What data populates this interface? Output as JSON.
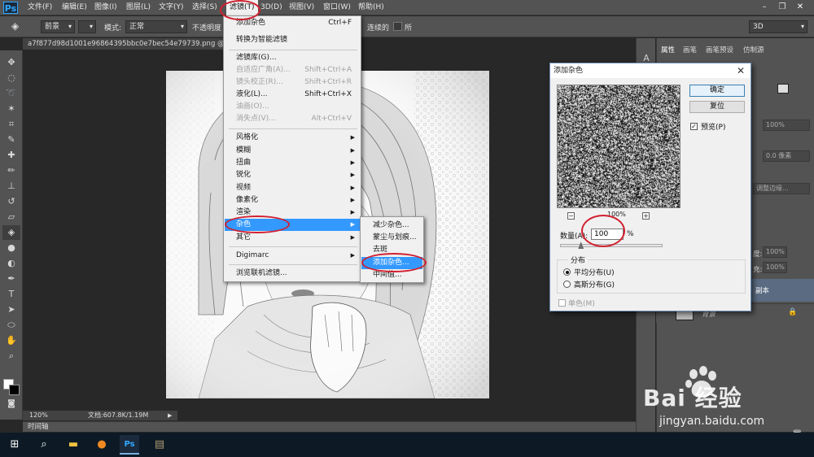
{
  "app": {
    "logo": "Ps"
  },
  "menubar": {
    "items": [
      "文件(F)",
      "编辑(E)",
      "图像(I)",
      "图层(L)",
      "文字(Y)",
      "选择(S)",
      "滤镜(T)",
      "3D(D)",
      "视图(V)",
      "窗口(W)",
      "帮助(H)"
    ],
    "window_controls": {
      "minimize": "–",
      "restore": "❐",
      "close": "✕"
    }
  },
  "options_bar": {
    "preset_value": "前景",
    "mode_label": "模式:",
    "mode_value": "正常",
    "opacity_label": "不透明度",
    "contiguous_label": "连续的",
    "all_layers_label": "所",
    "workspace_value": "3D"
  },
  "document": {
    "tab_title": "a7f877d98d1001e96864395bbc0e7bec54e79739.png @ 12",
    "zoom": "120%",
    "doc_size": "文档:607.8K/1.19M"
  },
  "timeline_label": "时间轴",
  "filter_menu": {
    "items": [
      {
        "label": "添加杂色",
        "shortcut": "Ctrl+F",
        "enabled": true
      },
      {
        "label": "转换为智能滤镜",
        "shortcut": "",
        "enabled": true
      },
      {
        "label": "滤镜库(G)...",
        "shortcut": "",
        "enabled": true
      },
      {
        "label": "自适应广角(A)...",
        "shortcut": "Shift+Ctrl+A",
        "enabled": false
      },
      {
        "label": "镜头校正(R)...",
        "shortcut": "Shift+Ctrl+R",
        "enabled": false
      },
      {
        "label": "液化(L)...",
        "shortcut": "Shift+Ctrl+X",
        "enabled": true
      },
      {
        "label": "油画(O)...",
        "shortcut": "",
        "enabled": false
      },
      {
        "label": "消失点(V)...",
        "shortcut": "Alt+Ctrl+V",
        "enabled": false
      },
      {
        "label": "风格化",
        "submenu": true
      },
      {
        "label": "模糊",
        "submenu": true
      },
      {
        "label": "扭曲",
        "submenu": true
      },
      {
        "label": "锐化",
        "submenu": true
      },
      {
        "label": "视频",
        "submenu": true
      },
      {
        "label": "像素化",
        "submenu": true
      },
      {
        "label": "渲染",
        "submenu": true
      },
      {
        "label": "杂色",
        "submenu": true,
        "highlighted": true
      },
      {
        "label": "其它",
        "submenu": true
      },
      {
        "label": "Digimarc",
        "submenu": true
      },
      {
        "label": "浏览联机滤镜...",
        "shortcut": ""
      }
    ]
  },
  "noise_submenu": {
    "items": [
      {
        "label": "减少杂色..."
      },
      {
        "label": "蒙尘与划痕..."
      },
      {
        "label": "去斑"
      },
      {
        "label": "添加杂色...",
        "highlighted": true
      },
      {
        "label": "中间值..."
      }
    ]
  },
  "dialog": {
    "title": "添加杂色",
    "close": "✕",
    "ok_label": "确定",
    "reset_label": "复位",
    "preview_label": "预览(P)",
    "preview_checked": true,
    "zoom_level": "100%",
    "zoom_out": "−",
    "zoom_in": "+",
    "amount_label": "数量(A):",
    "amount_value": "100",
    "amount_unit": "%",
    "amount_slider_fraction": 0.2,
    "distribution_label": "分布",
    "uniform_label": "平均分布(U)",
    "gaussian_label": "高斯分布(G)",
    "selected_distribution": "uniform",
    "mono_label": "单色(M)"
  },
  "right_panel": {
    "tabs": [
      "属性",
      "画笔",
      "画笔预设",
      "仿制源"
    ],
    "fields": [
      "100%",
      "0.0 像素",
      "调整边缘..."
    ],
    "opacity_field": "100%",
    "fill_field": "100%",
    "layer_label_a": "度:",
    "layer_label_b": "充:",
    "layer_copy_label": "副本",
    "background_layer_label": "背景"
  },
  "watermark": {
    "brand": "Bai 经验",
    "url": "jingyan.baidu.com"
  },
  "colors": {
    "accent": "#3399ff",
    "annotation": "#d2202f",
    "ui_dark": "#535353"
  }
}
